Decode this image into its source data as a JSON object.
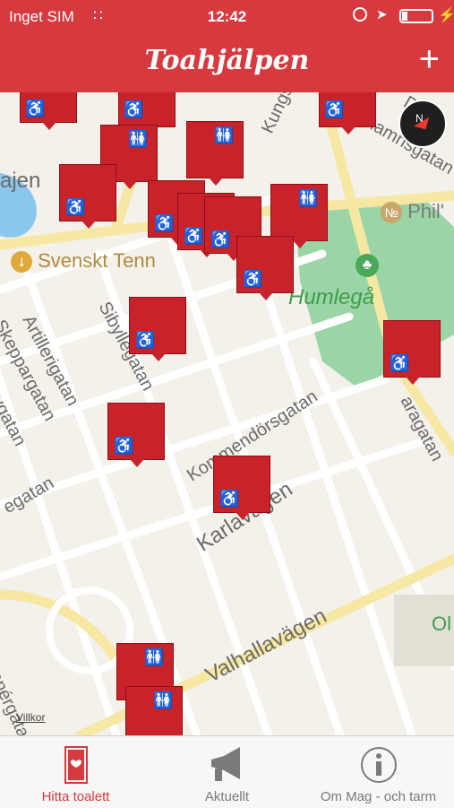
{
  "status_bar": {
    "carrier": "Inget SIM",
    "time": "12:42"
  },
  "nav": {
    "title": "Toahjälpen",
    "add_label": "+"
  },
  "map": {
    "poi_labels": [
      "Svenskt Tenn",
      "Phil'"
    ],
    "park_label": "Humlegå",
    "street_labels": [
      "Kungsgatan",
      "Artillerigatan",
      "Skeppargatan",
      "Sibyllegatan",
      "Kommendörsgatan",
      "Karlavägen",
      "Valhallavägen",
      "Banérgatan",
      "ajen",
      "egatan",
      "evgatan",
      "aragatan",
      "Debe",
      "hamnsgatan",
      "Ol"
    ],
    "legal_label": "Villkor",
    "compass_letter": "N",
    "markers_count": 18
  },
  "tabs": [
    {
      "label": "Hitta toalett",
      "icon": "toilet-door-icon",
      "active": true
    },
    {
      "label": "Aktuellt",
      "icon": "megaphone-icon",
      "active": false
    },
    {
      "label": "Om Mag - och tarm",
      "icon": "info-icon",
      "active": false
    }
  ],
  "colors": {
    "brand_red": "#d63a3f",
    "marker_red": "#c8232a",
    "park_green": "#8fd19e",
    "road_yellow": "#f6e7a2"
  }
}
